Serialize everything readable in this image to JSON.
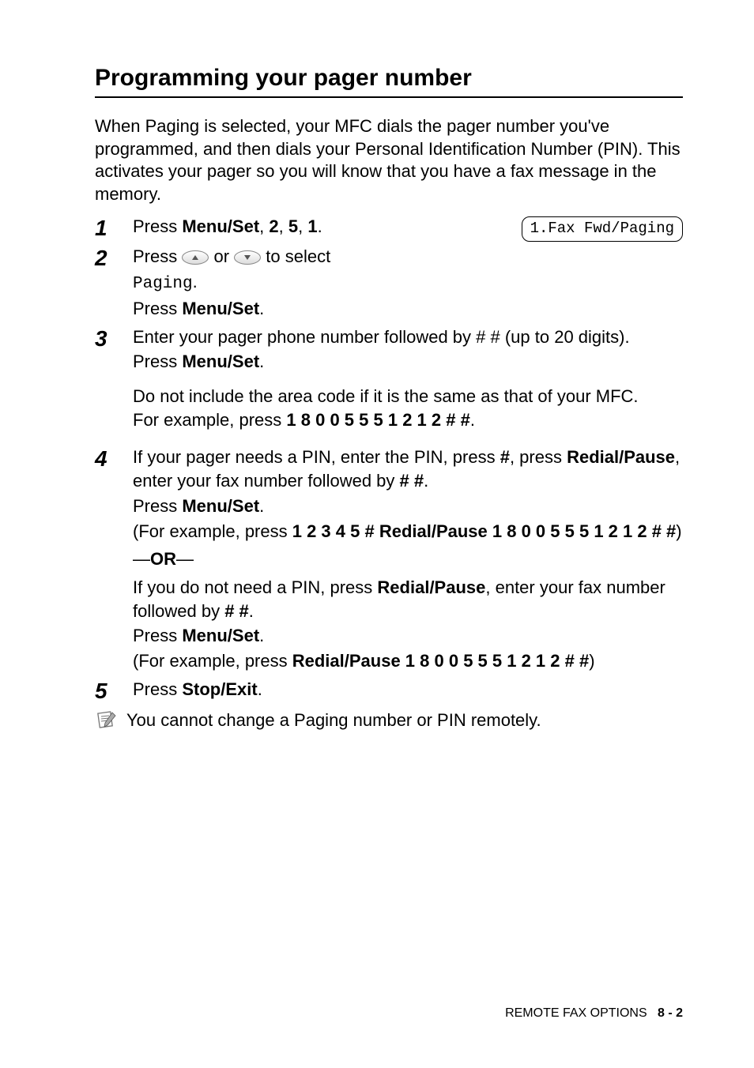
{
  "title": "Programming your pager number",
  "intro": "When Paging is selected, your MFC dials the pager number you've programmed, and then dials your Personal Identification Number (PIN). This activates your pager so you will know that you have a fax message in the memory.",
  "lcd": "1.Fax Fwd/Paging",
  "steps": {
    "s1": {
      "num": "1",
      "text_a": "Press ",
      "menu_set": "Menu/Set",
      "sep1": ", ",
      "k1": "2",
      "sep2": ", ",
      "k2": "5",
      "sep3": ", ",
      "k3": "1",
      "dot": "."
    },
    "s2": {
      "num": "2",
      "line1a": "Press ",
      "line1b": " or ",
      "line1c": "  to select",
      "paging": "Paging",
      "dot": ".",
      "press": "Press ",
      "menu_set": "Menu/Set",
      "dot2": "."
    },
    "s3": {
      "num": "3",
      "line1": "Enter your pager phone number followed by # # (up to 20 digits).",
      "press": "Press ",
      "menu_set": "Menu/Set",
      "dot": ".",
      "para2": "Do not include the area code if it is the same as that of your MFC.",
      "ex_a": "For example, press ",
      "ex_keys": "1 8 0 0 5 5 5 1 2 1 2 # #",
      "dot2": "."
    },
    "s4": {
      "num": "4",
      "line1a": "If your pager needs a PIN, enter the PIN, press ",
      "hash": "#",
      "line1b": ", press ",
      "redial": "Redial/Pause",
      "line1c": ", enter your fax number followed by ",
      "hh": "# #",
      "dot": ".",
      "press": "Press ",
      "menu_set": "Menu/Set",
      "dot2": ".",
      "ex1a": "(For example, press ",
      "ex1b": "1 2 3 4 5 # Redial/Pause 1 8 0 0 5 5 5 1 2 1 2 # #",
      "ex1c": ")",
      "or_dash1": "—",
      "or": "OR",
      "or_dash2": "—",
      "alt1a": "If you do not need a PIN, press ",
      "alt1b": ", enter your fax number followed by ",
      "dot3": ".",
      "press2": "Press ",
      "dot4": ".",
      "ex2a": "(For example, press ",
      "ex2b": "Redial/Pause 1 8 0 0 5 5 5 1 2 1 2 # #",
      "ex2c": ")"
    },
    "s5": {
      "num": "5",
      "press": "Press ",
      "stop": "Stop/Exit",
      "dot": "."
    }
  },
  "note": "You cannot change a Paging number or PIN remotely.",
  "footer": {
    "section": "REMOTE FAX OPTIONS",
    "page": "8 - 2"
  }
}
